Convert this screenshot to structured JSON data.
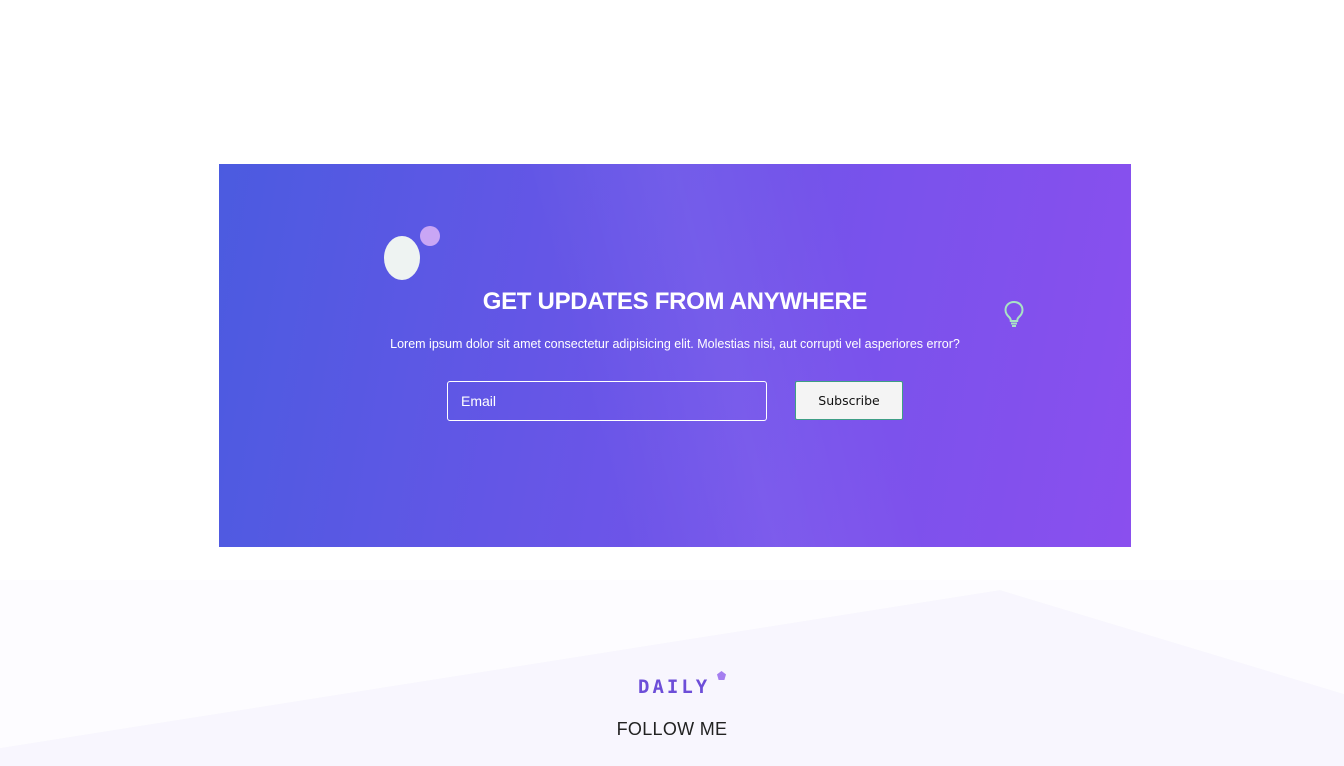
{
  "newsletter": {
    "title": "GET UPDATES FROM ANYWHERE",
    "text": "Lorem ipsum dolor sit amet consectetur adipisicing elit. Molestias nisi, aut corrupti vel asperiores error?",
    "email_placeholder": "Email",
    "subscribe_label": "Subscribe",
    "icon": "lightbulb-icon",
    "gradient_start": "#4b5be0",
    "gradient_end": "#8a4fee"
  },
  "footer": {
    "logo_text": "DAILY",
    "follow_label": "FOLLOW ME",
    "accent_color": "#6d4ed8"
  }
}
